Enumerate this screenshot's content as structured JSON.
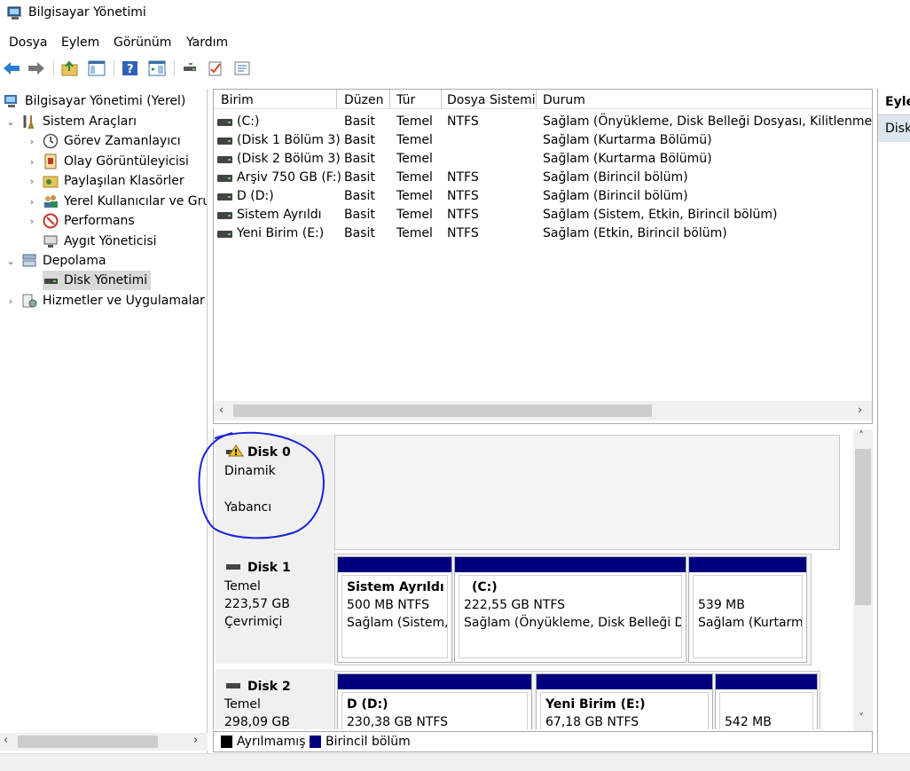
{
  "window": {
    "title": "Bilgisayar Yönetimi"
  },
  "menu": [
    "Dosya",
    "Eylem",
    "Görünüm",
    "Yardım"
  ],
  "toolbar": {
    "icons": [
      "back-arrow-icon",
      "forward-arrow-icon",
      "up-folder-icon",
      "show-hide-tree-icon",
      "help-icon",
      "show-hide-action-icon",
      "connect-icon",
      "checklist-icon",
      "properties-icon"
    ]
  },
  "tree": {
    "root": "Bilgisayar Yönetimi (Yerel)",
    "system_tools": "Sistem Araçları",
    "task_scheduler": "Görev Zamanlayıcı",
    "event_viewer": "Olay Görüntüleyicisi",
    "shared_folders": "Paylaşılan Klasörler",
    "local_users": "Yerel Kullanıcılar ve Grup",
    "performance": "Performans",
    "device_manager": "Aygıt Yöneticisi",
    "storage": "Depolama",
    "disk_management": "Disk Yönetimi",
    "services": "Hizmetler ve Uygulamalar"
  },
  "volumes": {
    "headers": {
      "birim": "Birim",
      "duzen": "Düzen",
      "tur": "Tür",
      "dosya": "Dosya Sistemi",
      "durum": "Durum"
    },
    "rows": [
      {
        "name": "(C:)",
        "layout": "Basit",
        "type": "Temel",
        "fs": "NTFS",
        "status": "Sağlam (Önyükleme, Disk Belleği Dosyası, Kilitlenme Bilg"
      },
      {
        "name": "(Disk 1 Bölüm 3)",
        "layout": "Basit",
        "type": "Temel",
        "fs": "",
        "status": "Sağlam (Kurtarma Bölümü)"
      },
      {
        "name": "(Disk 2 Bölüm 3)",
        "layout": "Basit",
        "type": "Temel",
        "fs": "",
        "status": "Sağlam (Kurtarma Bölümü)"
      },
      {
        "name": "Arşiv 750 GB (F:)",
        "layout": "Basit",
        "type": "Temel",
        "fs": "NTFS",
        "status": "Sağlam (Birincil bölüm)"
      },
      {
        "name": "D (D:)",
        "layout": "Basit",
        "type": "Temel",
        "fs": "NTFS",
        "status": "Sağlam (Birincil bölüm)"
      },
      {
        "name": "Sistem Ayrıldı",
        "layout": "Basit",
        "type": "Temel",
        "fs": "NTFS",
        "status": "Sağlam (Sistem, Etkin, Birincil bölüm)"
      },
      {
        "name": "Yeni Birim (E:)",
        "layout": "Basit",
        "type": "Temel",
        "fs": "NTFS",
        "status": "Sağlam (Etkin, Birincil bölüm)"
      }
    ]
  },
  "disks": {
    "disk0": {
      "name": "Disk 0",
      "kind": "Dinamik",
      "state": "Yabancı"
    },
    "disk1": {
      "name": "Disk 1",
      "kind": "Temel",
      "size": "223,57 GB",
      "state": "Çevrimiçi",
      "parts": [
        {
          "title": "Sistem Ayrıldı",
          "size": "500 MB NTFS",
          "status": "Sağlam (Sistem, E"
        },
        {
          "title": "(C:)",
          "size": "222,55 GB NTFS",
          "status": "Sağlam (Önyükleme, Disk Belleği Do"
        },
        {
          "title": "",
          "size": "539 MB",
          "status": "Sağlam (Kurtarma"
        }
      ]
    },
    "disk2": {
      "name": "Disk 2",
      "kind": "Temel",
      "size": "298,09 GB",
      "parts": [
        {
          "title": "D  (D:)",
          "size": "230,38 GB NTFS"
        },
        {
          "title": "Yeni Birim  (E:)",
          "size": "67,18 GB NTFS"
        },
        {
          "title": "",
          "size": "542 MB"
        }
      ]
    }
  },
  "legend": {
    "unallocated": "Ayrılmamış",
    "primary": "Birincil bölüm",
    "unallocated_color": "#000000",
    "primary_color": "#00007f"
  },
  "actions": {
    "header": "Eyler",
    "item": "Disk"
  }
}
